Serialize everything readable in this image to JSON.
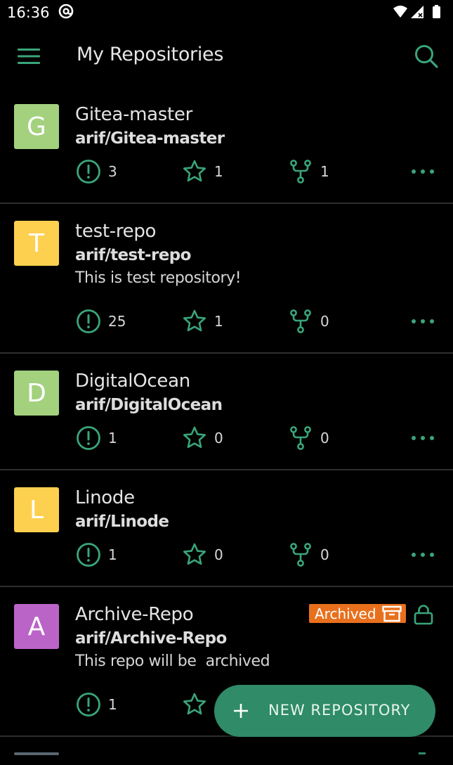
{
  "status_bar": {
    "time": "16:36"
  },
  "app_bar": {
    "title": "My Repositories",
    "menu_icon": "menu-icon",
    "search_icon": "search-icon"
  },
  "colors": {
    "accent": "#3aa57a",
    "fab": "#2f8b68",
    "archived_badge": "#e8701d",
    "avatar_green": "#a3d17e",
    "avatar_yellow": "#fdd04f",
    "avatar_purple": "#bb64c8"
  },
  "repos": [
    {
      "initial": "G",
      "name": "Gitea-master",
      "full_name": "arif/Gitea-master",
      "description": "",
      "issues": "3",
      "stars": "1",
      "forks": "1"
    },
    {
      "initial": "T",
      "name": "test-repo",
      "full_name": "arif/test-repo",
      "description": "This is test repository!",
      "issues": "25",
      "stars": "1",
      "forks": "0"
    },
    {
      "initial": "D",
      "name": "DigitalOcean",
      "full_name": "arif/DigitalOcean",
      "description": "",
      "issues": "1",
      "stars": "0",
      "forks": "0"
    },
    {
      "initial": "L",
      "name": "Linode",
      "full_name": "arif/Linode",
      "description": "",
      "issues": "1",
      "stars": "0",
      "forks": "0"
    },
    {
      "initial": "A",
      "name": "Archive-Repo",
      "full_name": "arif/Archive-Repo",
      "description": "This repo will be  archived",
      "issues": "1",
      "badge": "Archived",
      "private": true
    }
  ],
  "fab": {
    "label": "NEW REPOSITORY"
  }
}
